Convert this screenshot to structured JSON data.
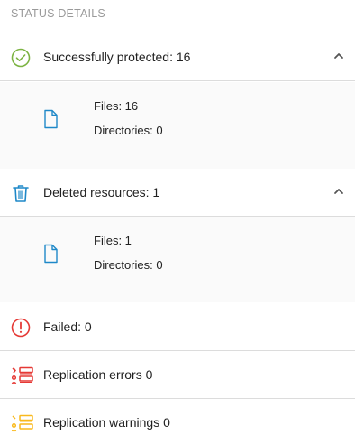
{
  "header": {
    "title": "STATUS DETAILS"
  },
  "protected": {
    "label": "Successfully protected: 16",
    "icon": "check-circle-icon",
    "color": "#7cb342",
    "details": {
      "files": "Files: 16",
      "directories": "Directories: 0"
    }
  },
  "deleted": {
    "label": "Deleted resources: 1",
    "icon": "trash-icon",
    "color": "#1e88c8",
    "details": {
      "files": "Files: 1",
      "directories": "Directories: 0"
    }
  },
  "failed": {
    "label": "Failed: 0",
    "icon": "alert-circle-icon",
    "color": "#e53935"
  },
  "replication_errors": {
    "label": "Replication errors 0",
    "icon": "replication-error-icon",
    "color": "#e53935"
  },
  "replication_warnings": {
    "label": "Replication warnings 0",
    "icon": "replication-warning-icon",
    "color": "#f9b91d"
  },
  "colors": {
    "file_icon": "#1e88c8",
    "divider": "#dcdcdc",
    "detail_bg": "#fafafa"
  }
}
